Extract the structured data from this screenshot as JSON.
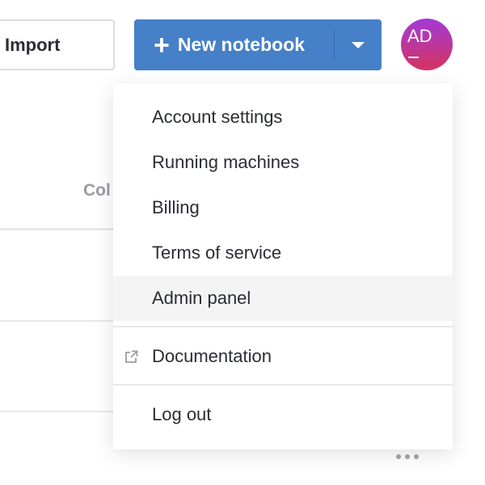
{
  "toolbar": {
    "import_label": "Import",
    "new_notebook_label": "New notebook",
    "plus_icon": "+"
  },
  "avatar": {
    "initials": "AD"
  },
  "table": {
    "column_header_partial": "Col"
  },
  "menu": {
    "items": [
      {
        "label": "Account settings"
      },
      {
        "label": "Running machines"
      },
      {
        "label": "Billing"
      },
      {
        "label": "Terms of service"
      },
      {
        "label": "Admin panel"
      },
      {
        "label": "Documentation",
        "icon": "external-link-icon"
      },
      {
        "label": "Log out"
      }
    ]
  },
  "colors": {
    "accent": "#4580c9",
    "hover": "#f4f4f5"
  }
}
